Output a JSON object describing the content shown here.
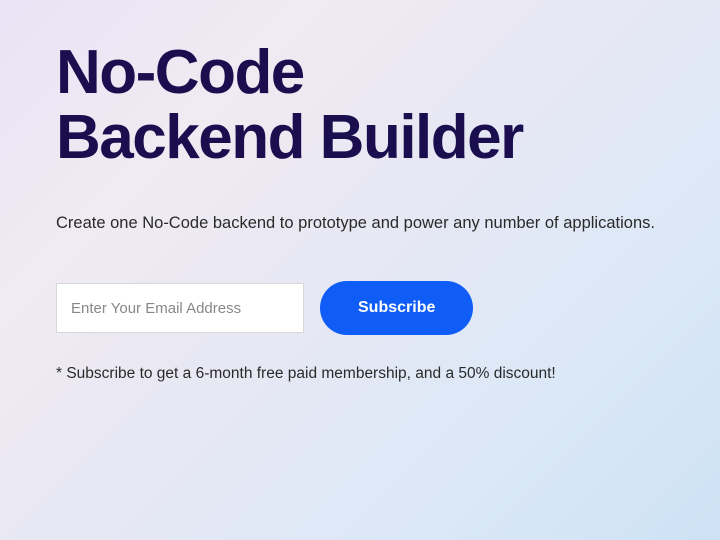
{
  "hero": {
    "title_line1": "No-Code",
    "title_line2": "Backend Builder",
    "subtitle": "Create one No-Code backend to prototype and power any number of applications."
  },
  "form": {
    "email_placeholder": "Enter Your Email Address",
    "subscribe_label": "Subscribe"
  },
  "disclaimer": "* Subscribe to get a 6-month free paid membership, and a 50% discount!"
}
